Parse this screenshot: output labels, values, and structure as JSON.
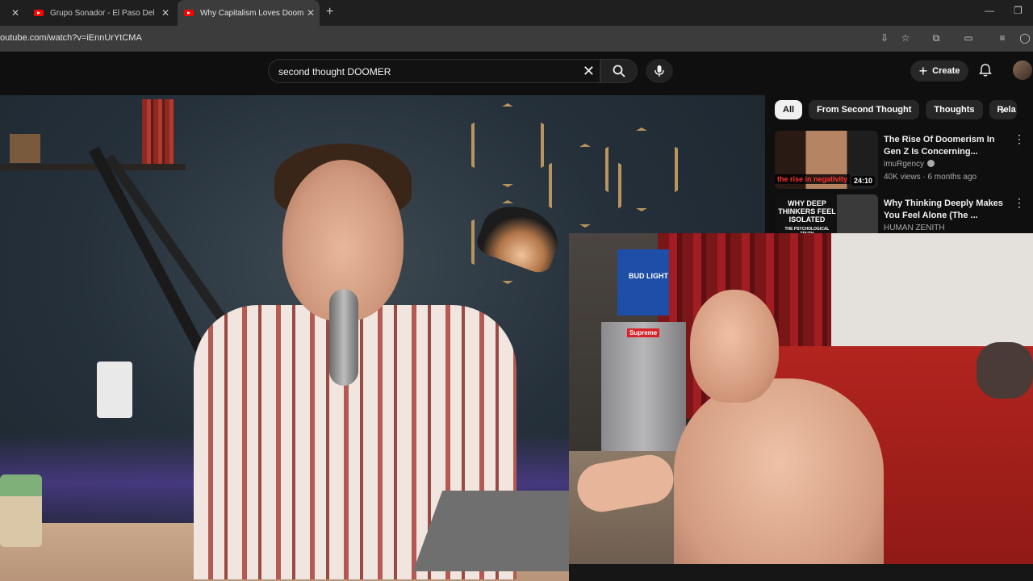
{
  "browser": {
    "tabs": [
      {
        "label": "Grupo Sonador - El Paso Del Gi",
        "active": false
      },
      {
        "label": "Why Capitalism Loves Doomer",
        "active": true
      }
    ],
    "new_tab_label": "+",
    "url": "outube.com/watch?v=iEnnUrYtCMA"
  },
  "youtube": {
    "search_query": "second thought DOOMER",
    "create_label": "Create"
  },
  "sidebar": {
    "chips": [
      {
        "label": "All",
        "active": true
      },
      {
        "label": "From Second Thought",
        "active": false
      },
      {
        "label": "Thoughts",
        "active": false
      },
      {
        "label": "Rela",
        "active": false
      }
    ],
    "recommendations": [
      {
        "title": "The Rise Of Doomerism In Gen Z Is Concerning...",
        "channel": "imuRgency",
        "verified": true,
        "views": "40K views",
        "age": "6 months ago",
        "duration": "24:10",
        "thumb_text": "the rise in negativity"
      },
      {
        "title": "Why Thinking Deeply Makes You Feel Alone (The ...",
        "channel": "HUMAN ZENITH",
        "verified": false,
        "thumb_text": "WHY DEEP THINKERS FEEL ISOLATED",
        "thumb_subtext": "THE PSYCHOLOGICAL TRUTH"
      }
    ]
  },
  "webcam": {
    "box_label": "BUD LIGHT",
    "sticker": "Supreme"
  }
}
